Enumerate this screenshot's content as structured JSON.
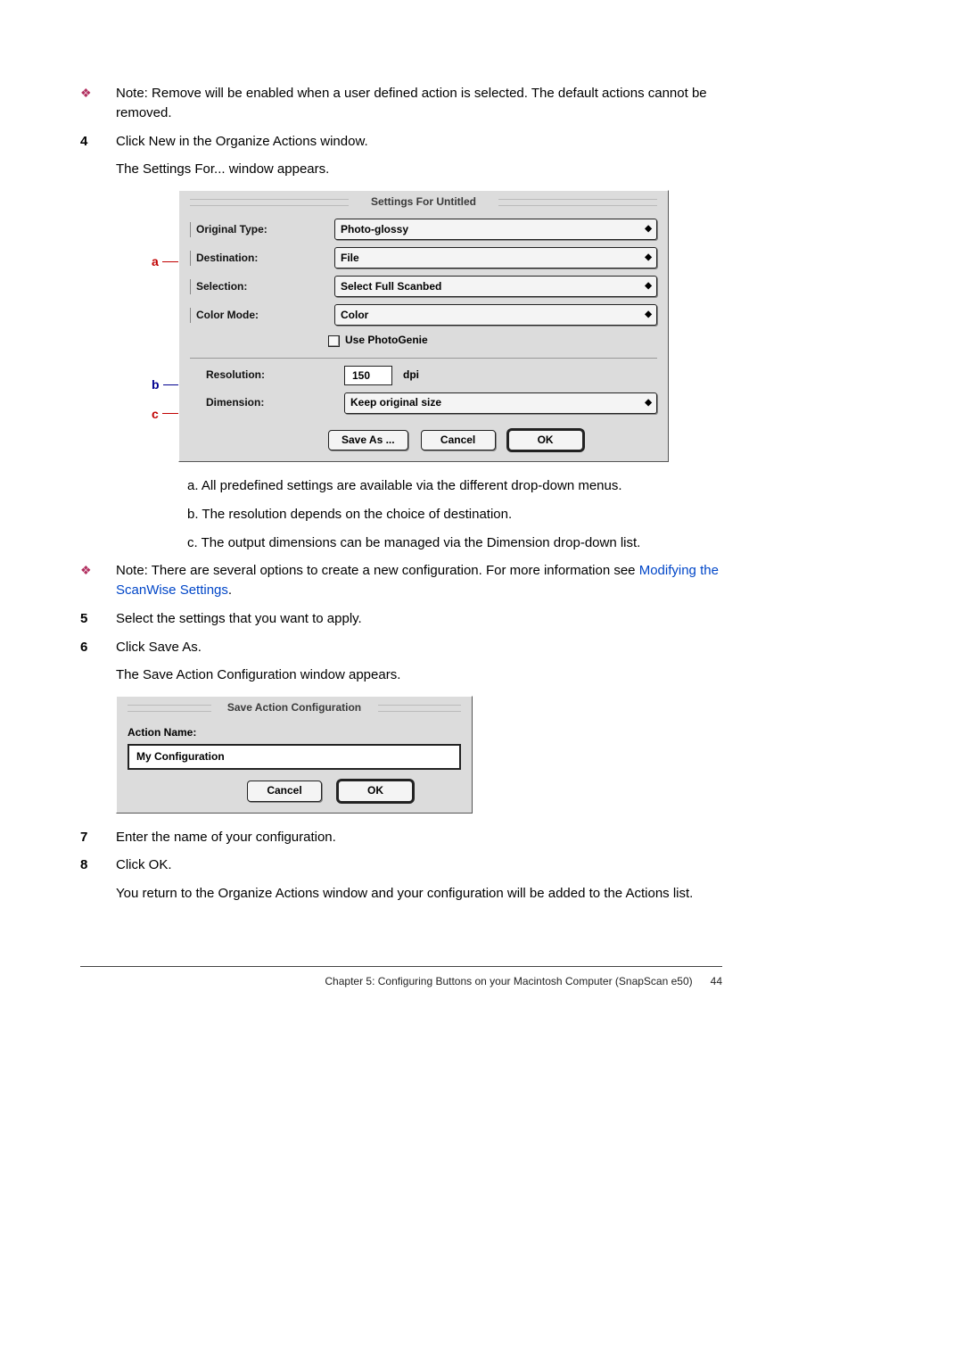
{
  "notes": {
    "removeNote": "Note: Remove will be enabled when a user defined action is selected. The default actions cannot be removed.",
    "optionsNote": "Note: There are several options to create a new configuration. For more information see ",
    "optionsLink": "Modifying the ScanWise Settings",
    "optionsPeriod": "."
  },
  "steps": {
    "s4": {
      "num": "4",
      "text": "Click New in the Organize Actions window.",
      "sub": "The Settings For... window appears."
    },
    "s5": {
      "num": "5",
      "text": "Select the settings that you want to apply."
    },
    "s6": {
      "num": "6",
      "text": "Click Save As.",
      "sub": "The Save Action Configuration window appears."
    },
    "s7": {
      "num": "7",
      "text": "Enter the name of your configuration."
    },
    "s8": {
      "num": "8",
      "text": "Click OK.",
      "sub": "You return to the Organize Actions window and your configuration will be added to the Actions list."
    }
  },
  "dlg1": {
    "title": "Settings For Untitled",
    "labels": {
      "originalType": "Original Type:",
      "destination": "Destination:",
      "selection": "Selection:",
      "colorMode": "Color Mode:",
      "usePhotoGenie": "Use PhotoGenie",
      "resolution": "Resolution:",
      "dimension": "Dimension:",
      "dpi": "dpi"
    },
    "values": {
      "originalType": "Photo-glossy",
      "destination": "File",
      "selection": "Select Full Scanbed",
      "colorMode": "Color",
      "resolution": "150",
      "dimension": "Keep original size"
    },
    "buttons": {
      "saveAs": "Save As ...",
      "cancel": "Cancel",
      "ok": "OK"
    }
  },
  "captions": {
    "a": "a. All predefined settings are available via the different drop-down menus.",
    "b": "b. The resolution depends on the choice of destination.",
    "c": "c. The output dimensions can be managed via the Dimension drop-down list."
  },
  "callouts": {
    "a": "a",
    "b": "b",
    "c": "c"
  },
  "dlg2": {
    "title": "Save Action Configuration",
    "label": "Action Name:",
    "value": "My Configuration",
    "buttons": {
      "cancel": "Cancel",
      "ok": "OK"
    }
  },
  "footer": {
    "left": "Chapter 5: Configuring Buttons on your Macintosh Computer (SnapScan e50)",
    "page": "44"
  },
  "glyphs": {
    "diamondBullet": "❖",
    "updown": "◆"
  }
}
